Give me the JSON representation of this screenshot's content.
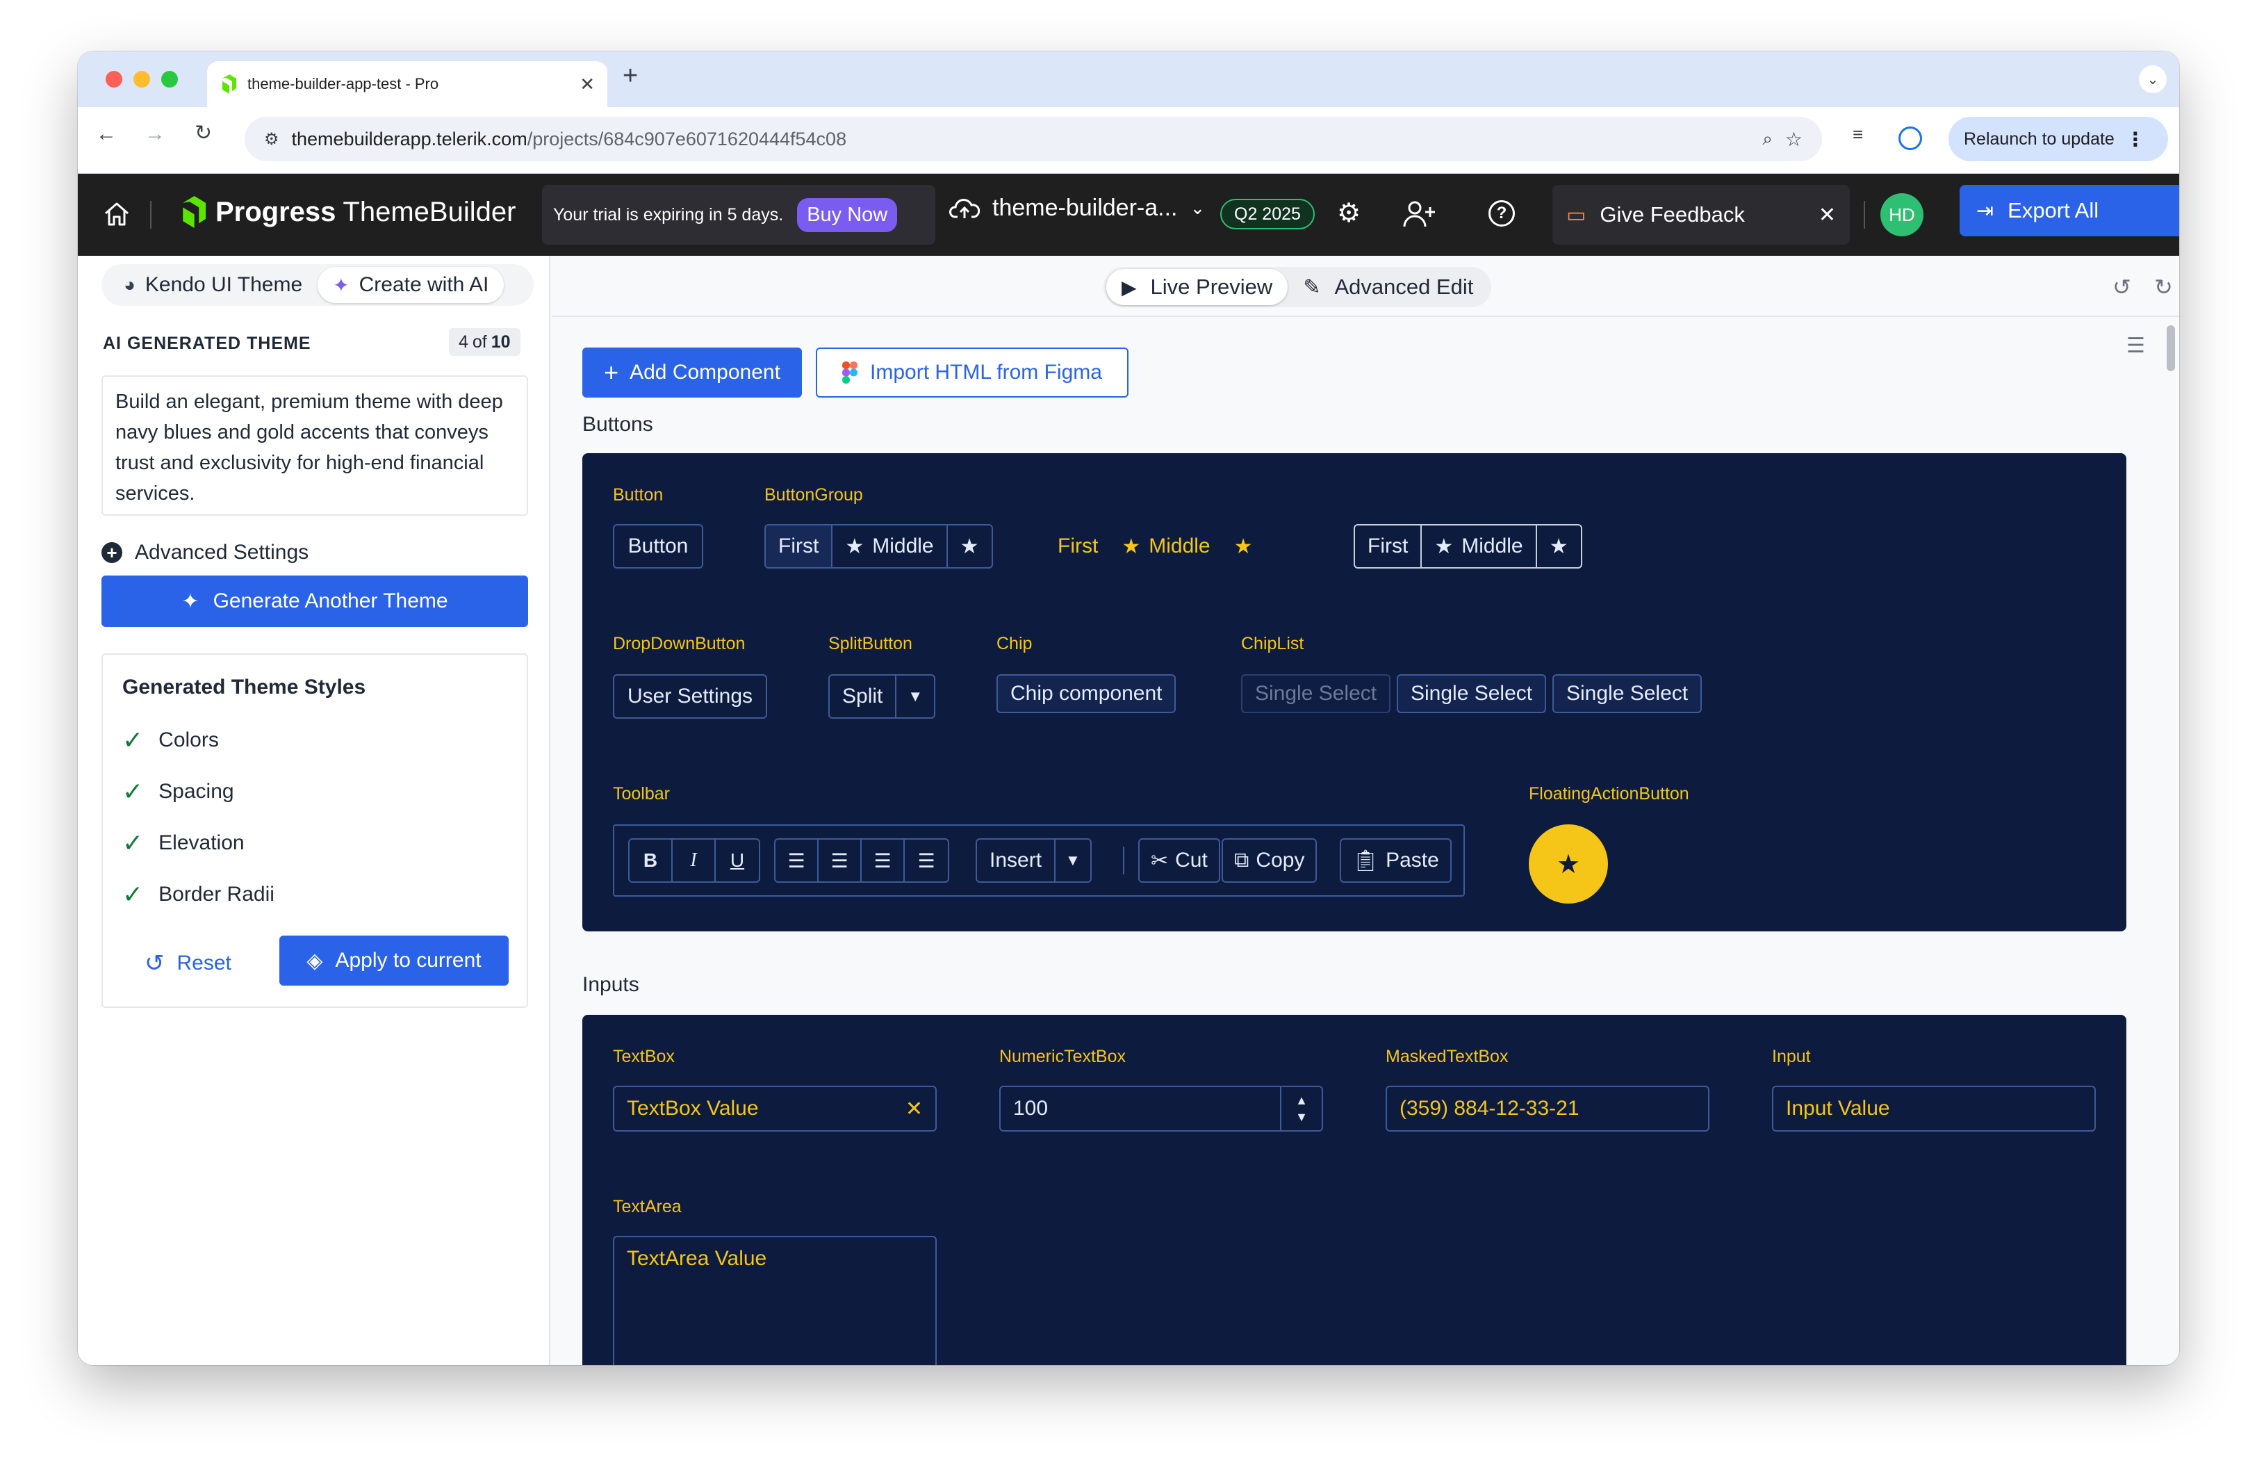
{
  "browser": {
    "tab_title": "theme-builder-app-test - Pro",
    "url_host": "themebuilderapp.telerik.com",
    "url_path": "/projects/684c907e6071620444f54c08",
    "relaunch": "Relaunch to update"
  },
  "header": {
    "logo_brand": "Progress",
    "logo_product": "ThemeBuilder",
    "trial_text": "Your trial is expiring in 5 days.",
    "buy_now": "Buy Now",
    "project_name": "theme-builder-a...",
    "version": "Q2 2025",
    "feedback": "Give Feedback",
    "avatar": "HD",
    "export": "Export All"
  },
  "sidebar": {
    "tab_kendo": "Kendo UI Theme",
    "tab_ai": "Create with AI",
    "section_label": "AI GENERATED THEME",
    "counter_current": "4",
    "counter_of": "of",
    "counter_total": "10",
    "prompt": "Build an elegant, premium theme with deep navy blues and gold accents that conveys trust and exclusivity for high-end financial services.",
    "advanced": "Advanced Settings",
    "generate": "Generate Another Theme",
    "styles_title": "Generated Theme Styles",
    "styles": [
      "Colors",
      "Spacing",
      "Elevation",
      "Border Radii"
    ],
    "reset": "Reset",
    "apply": "Apply to current"
  },
  "main": {
    "live_preview": "Live Preview",
    "advanced_edit": "Advanced Edit",
    "add_component": "Add Component",
    "import_figma": "Import HTML from Figma",
    "buttons_heading": "Buttons",
    "inputs_heading": "Inputs"
  },
  "buttons_panel": {
    "button_label": "Button",
    "button_text": "Button",
    "buttongroup_label": "ButtonGroup",
    "group_first": "First",
    "group_middle": "Middle",
    "dropdown_label": "DropDownButton",
    "dropdown_text": "User Settings",
    "split_label": "SplitButton",
    "split_text": "Split",
    "chip_label": "Chip",
    "chip_text": "Chip component",
    "chiplist_label": "ChipList",
    "chips": [
      "Single Select",
      "Single Select",
      "Single Select"
    ],
    "toolbar_label": "Toolbar",
    "tb_bold": "B",
    "tb_italic": "I",
    "tb_underline": "U",
    "tb_insert": "Insert",
    "tb_cut": "Cut",
    "tb_copy": "Copy",
    "tb_paste": "Paste",
    "fab_label": "FloatingActionButton"
  },
  "inputs_panel": {
    "textbox_label": "TextBox",
    "textbox_value": "TextBox Value",
    "numeric_label": "NumericTextBox",
    "numeric_value": "100",
    "masked_label": "MaskedTextBox",
    "masked_value": "(359) 884-12-33-21",
    "input_label": "Input",
    "input_value": "Input Value",
    "textarea_label": "TextArea",
    "textarea_value": "TextArea Value"
  },
  "colors": {
    "panel": "#0d1b3e",
    "accent": "#f5c518",
    "primary": "#2a63e8"
  }
}
